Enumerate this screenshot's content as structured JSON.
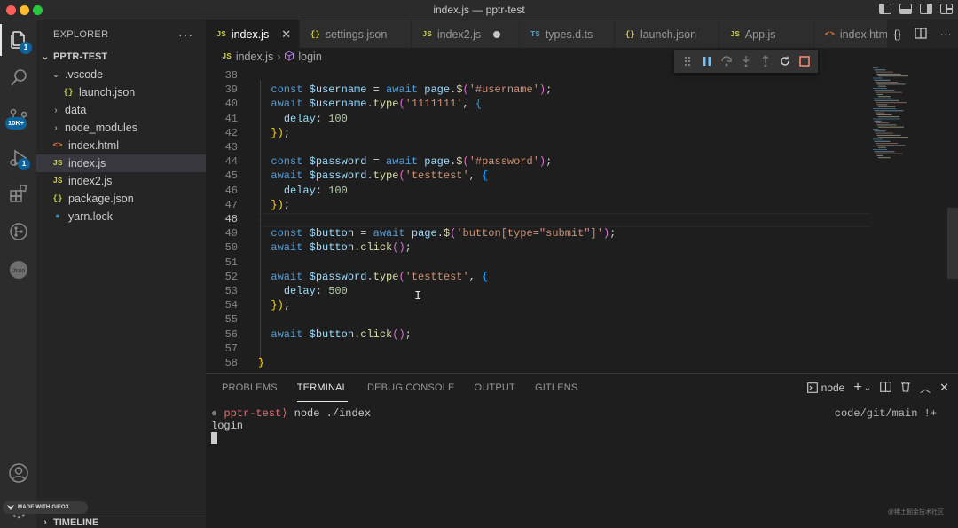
{
  "window": {
    "title": "index.js — pptr-test"
  },
  "activity": {
    "explorer_badge": "1",
    "scm_badge": "10K+",
    "debug_badge": "1"
  },
  "sidebar": {
    "header": "EXPLORER",
    "more": "···",
    "section": "PPTR-TEST",
    "items": [
      {
        "label": ".vscode",
        "type": "folder-open",
        "icon": ""
      },
      {
        "label": "launch.json",
        "type": "file",
        "icon": "{}"
      },
      {
        "label": "data",
        "type": "folder",
        "icon": ""
      },
      {
        "label": "node_modules",
        "type": "folder",
        "icon": ""
      },
      {
        "label": "index.html",
        "type": "file",
        "icon": "<>"
      },
      {
        "label": "index.js",
        "type": "file",
        "icon": "JS"
      },
      {
        "label": "index2.js",
        "type": "file",
        "icon": "JS"
      },
      {
        "label": "package.json",
        "type": "file",
        "icon": "{}"
      },
      {
        "label": "yarn.lock",
        "type": "file",
        "icon": "yarn"
      }
    ],
    "timeline": "TIMELINE"
  },
  "tabs": [
    {
      "label": "index.js",
      "icon": "JS",
      "state": "active-close"
    },
    {
      "label": "settings.json",
      "icon": "{}",
      "state": ""
    },
    {
      "label": "index2.js",
      "icon": "JS",
      "state": "dirty"
    },
    {
      "label": "types.d.ts",
      "icon": "TS",
      "state": ""
    },
    {
      "label": "launch.json",
      "icon": "{}",
      "state": ""
    },
    {
      "label": "App.js",
      "icon": "JS",
      "state": ""
    },
    {
      "label": "index.html",
      "icon": "<>",
      "state": ""
    }
  ],
  "breadcrumb": {
    "file_icon": "JS",
    "file": "index.js",
    "symbol": "login"
  },
  "editor": {
    "current_line": 48,
    "lines": [
      {
        "n": "38",
        "t": ""
      },
      {
        "n": "39",
        "t": "  const $username = await page.$('#username');"
      },
      {
        "n": "40",
        "t": "  await $username.type('1111111', {"
      },
      {
        "n": "41",
        "t": "    delay: 100"
      },
      {
        "n": "42",
        "t": "  });"
      },
      {
        "n": "43",
        "t": ""
      },
      {
        "n": "44",
        "t": "  const $password = await page.$('#password');"
      },
      {
        "n": "45",
        "t": "  await $password.type('testtest', {"
      },
      {
        "n": "46",
        "t": "    delay: 100"
      },
      {
        "n": "47",
        "t": "  });"
      },
      {
        "n": "48",
        "t": ""
      },
      {
        "n": "49",
        "t": "  const $button = await page.$('button[type=\"submit\"]');"
      },
      {
        "n": "50",
        "t": "  await $button.click();"
      },
      {
        "n": "51",
        "t": ""
      },
      {
        "n": "52",
        "t": "  await $password.type('testtest', {"
      },
      {
        "n": "53",
        "t": "    delay: 500"
      },
      {
        "n": "54",
        "t": "  });"
      },
      {
        "n": "55",
        "t": ""
      },
      {
        "n": "56",
        "t": "  await $button.click();"
      },
      {
        "n": "57",
        "t": ""
      },
      {
        "n": "58",
        "t": "}"
      }
    ]
  },
  "panel": {
    "tabs": [
      "PROBLEMS",
      "TERMINAL",
      "DEBUG CONSOLE",
      "OUTPUT",
      "GITLENS"
    ],
    "active_tab": "TERMINAL",
    "shell": "node",
    "terminal": {
      "prompt_dir": "pptr-test",
      "command": " node ./index",
      "output": "login",
      "right_status": "code/git/main !+"
    }
  },
  "overlay": {
    "gifox": "MADE WITH GIFOX",
    "watermark": "@稀土掘金技术社区"
  },
  "colors": {
    "accent": "#0e639c",
    "keyword": "#569cd6",
    "variable": "#9cdcfe",
    "function": "#dcdcaa",
    "string": "#ce9178",
    "number": "#b5cea8"
  }
}
